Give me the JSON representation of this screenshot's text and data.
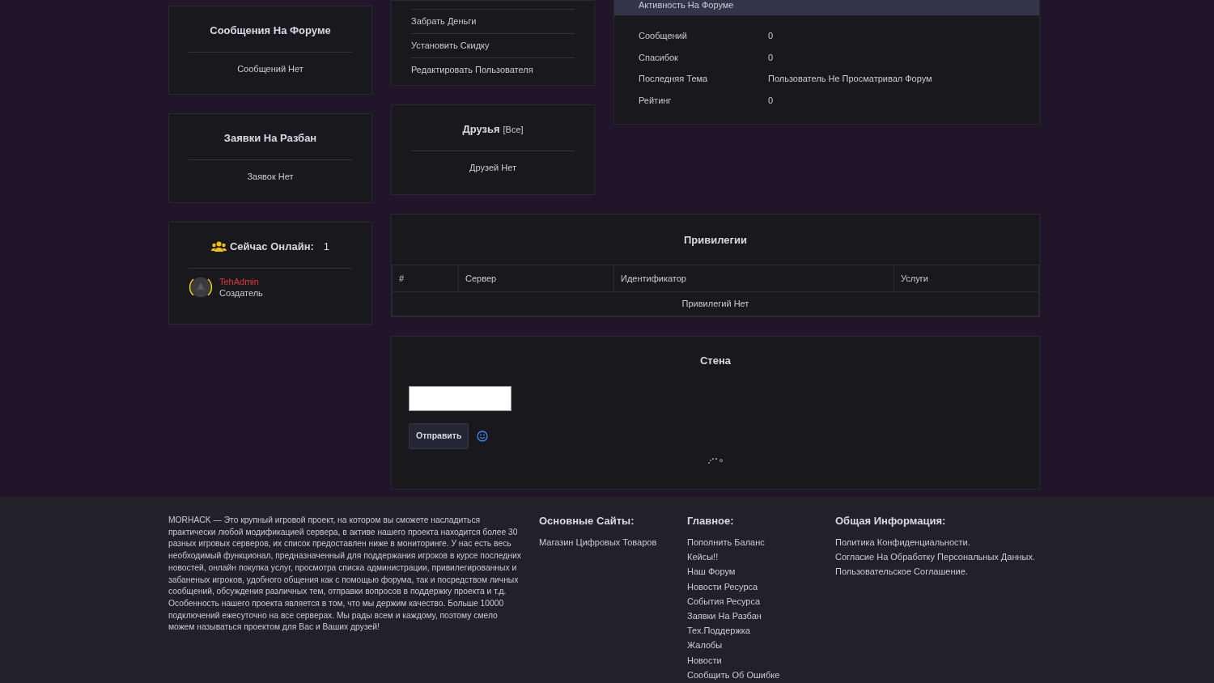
{
  "forum_messages_card": {
    "title": "Сообщения На Форуме",
    "empty_text": "Сообщений Нет"
  },
  "ban_requests_card": {
    "title": "Заявки На Разбан",
    "empty_text": "Заявок Нет"
  },
  "online_card": {
    "title": "Сейчас Онлайн:",
    "count": "1",
    "users": [
      {
        "name": "TehAdmin",
        "role": "Создатель"
      }
    ]
  },
  "user_actions": [
    "Забрать Деньги",
    "Установить Скидку",
    "Редактировать Пользователя"
  ],
  "friends_card": {
    "title": "Друзья",
    "link": "[Все]",
    "empty_text": "Друзей Нет"
  },
  "forum_activity": {
    "title": "Активность На Форуме",
    "rows": [
      {
        "label": "Сообщений",
        "value": "0"
      },
      {
        "label": "Спасибок",
        "value": "0"
      },
      {
        "label": "Последняя Тема",
        "value": "Пользователь Не Просматривал Форум"
      },
      {
        "label": "Рейтинг",
        "value": "0"
      }
    ]
  },
  "privileges": {
    "title": "Привилегии",
    "columns": [
      "#",
      "Сервер",
      "Идентификатор",
      "Услуги"
    ],
    "empty_text": "Привилегий Нет"
  },
  "wall": {
    "title": "Стена",
    "send_button": "Отправить"
  },
  "footer": {
    "about": "MORHACK — Это крупный игровой проект, на котором вы сможете насладиться практически любой модификацией сервера, в активе нашего проекта находится более 30 разных игровых серверов, их список предоставлен ниже в мониторинге. У нас есть весь необходимый функционал, предназначенный для поддержания игроков в курсе последних новостей, онлайн покупка услуг, просмотра списка администрации, привилегированных и забаненых игроков, удобного общения как с помощью форума, так и посредством личных сообщений, обсуждения различных тем, отправки вопросов в поддержку проекта и т.д. Особенность нашего проекта является в том, что мы держим качество. Больше 10000 подключений ежесуточно на все серверах. Мы рады всем и каждому, поэтому смело можем называться проектом для Вас и Ваших друзей!",
    "columns": [
      {
        "title": "Основные Сайты:",
        "links": [
          "Магазин Цифровых Товаров"
        ]
      },
      {
        "title": "Главное:",
        "links": [
          "Пополнить Баланс",
          "Кейсы!!",
          "Наш Форум",
          "Новости Ресурса",
          "События Ресурса",
          "Заявки На Разбан",
          "Тех.Поддержка",
          "Жалобы",
          "Новости",
          "Сообщить Об Ошибке"
        ]
      },
      {
        "title": "Общая Информация:",
        "links": [
          "Политика Конфиденциальности.",
          "Согласие На Обработку Персональных Данных.",
          "Пользовательское Соглашение."
        ]
      }
    ]
  }
}
